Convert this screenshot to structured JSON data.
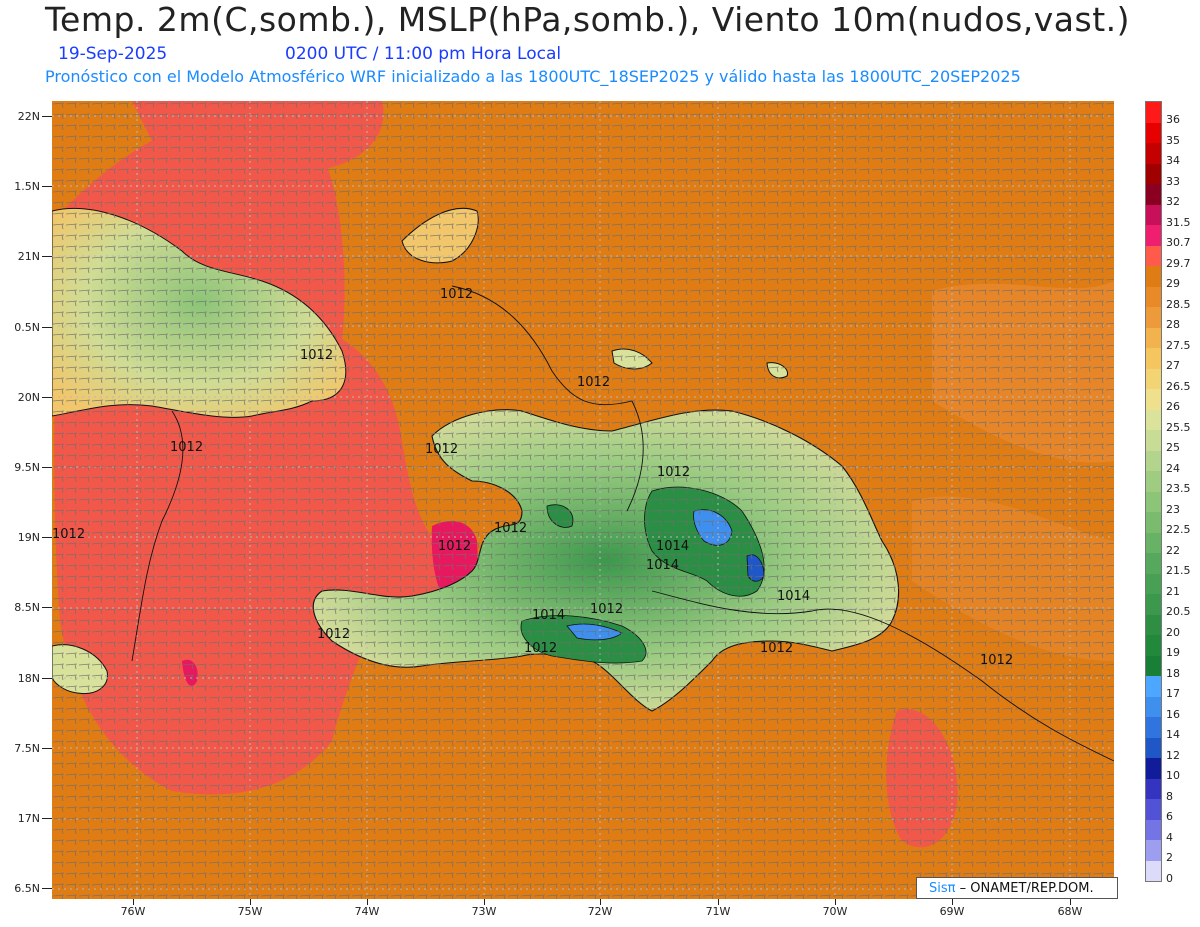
{
  "header": {
    "title": "Temp. 2m(C,somb.), MSLP(hPa,somb.), Viento 10m(nudos,vast.)",
    "date": "19-Sep-2025",
    "time": "0200 UTC / 11:00 pm Hora Local",
    "description": "Pronóstico con el Modelo Atmosférico WRF inicializado a las 1800UTC_18SEP2025 y válido hasta las  1800UTC_20SEP2025"
  },
  "axes": {
    "lat_labels": [
      "22N",
      "1.5N",
      "21N",
      "0.5N",
      "20N",
      "9.5N",
      "19N",
      "8.5N",
      "18N",
      "7.5N",
      "17N",
      "6.5N"
    ],
    "lon_labels": [
      "76W",
      "75W",
      "74W",
      "73W",
      "72W",
      "71W",
      "70W",
      "69W",
      "68W"
    ]
  },
  "isobars": {
    "labels": [
      "1012",
      "1012",
      "1012",
      "1012",
      "1012",
      "1012",
      "1012",
      "1012",
      "1012",
      "1012",
      "1012",
      "1012",
      "1012",
      "1014",
      "1014",
      "1014",
      "1014"
    ]
  },
  "colorbar": {
    "labels": [
      "36",
      "35",
      "34",
      "33",
      "32",
      "31.5",
      "30.7",
      "29.7",
      "29",
      "28.5",
      "28",
      "27.5",
      "27",
      "26.5",
      "26",
      "25.5",
      "25",
      "24",
      "23.5",
      "23",
      "22.5",
      "22",
      "21.5",
      "21",
      "20.5",
      "20",
      "19",
      "18",
      "17",
      "16",
      "14",
      "12",
      "10",
      "8",
      "6",
      "4",
      "2",
      "0"
    ],
    "colors": [
      "#ff1a1a",
      "#e60000",
      "#c40000",
      "#a00000",
      "#8b0020",
      "#c8105a",
      "#f01e6e",
      "#ff5a4a",
      "#e07c14",
      "#e88a28",
      "#ec9a3a",
      "#f2b24e",
      "#f5c660",
      "#f2d474",
      "#eee08c",
      "#dbe29a",
      "#c8dc96",
      "#b2d48c",
      "#a0cc82",
      "#8cc478",
      "#7abb6e",
      "#68b266",
      "#56a85c",
      "#48a054",
      "#3c984c",
      "#2e8f44",
      "#22883c",
      "#1a7f36",
      "#4da6ff",
      "#3f8fef",
      "#2f74df",
      "#1f57c8",
      "#101c9a",
      "#3434c0",
      "#5252d6",
      "#7474e4",
      "#9e9ef0",
      "#dcdcfa"
    ]
  },
  "credit": {
    "sis": "Sisπ",
    "rest": " – ONAMET/REP.DOM."
  },
  "colors": {
    "sea": "#e07c14",
    "warm_water": "#f2584a",
    "hot_spot": "#e8185e",
    "land_low": "#d8e29a",
    "land_green": "#52a85a",
    "land_mountain": "#2a8f44",
    "land_blue": "#3f8fef",
    "grid": "#b0b0b0",
    "wind_barb": "#6a6a6a",
    "isobar": "#111111"
  }
}
